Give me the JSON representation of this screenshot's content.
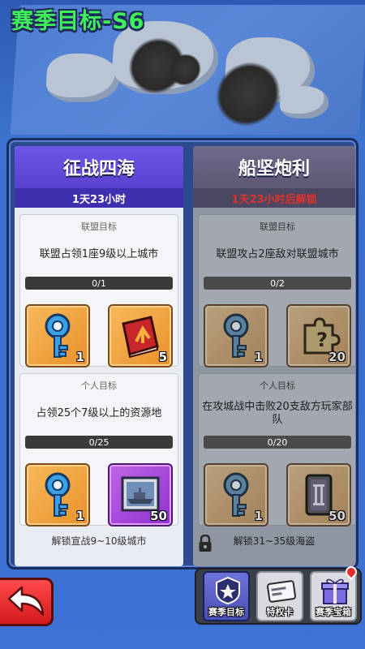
{
  "header": {
    "title": "赛季目标-S6"
  },
  "columns": [
    {
      "name": "征战四海",
      "time": "1天23小时",
      "locked": false,
      "alliance": {
        "label": "联盟目标",
        "task": "联盟占领1座9级以上城市",
        "progress": "0/1",
        "rewards": [
          {
            "icon": "blue-key-icon",
            "qty": "1"
          },
          {
            "icon": "red-book-icon",
            "qty": "5"
          }
        ]
      },
      "personal": {
        "label": "个人目标",
        "task": "占领25个7级以上的资源地",
        "progress": "0/25",
        "rewards": [
          {
            "icon": "blue-key-icon",
            "qty": "1"
          },
          {
            "icon": "warship-card-icon",
            "qty": "50"
          }
        ]
      },
      "unlock": "解锁宣战9~10级城市"
    },
    {
      "name": "船坚炮利",
      "time": "1天23小时后解锁",
      "locked": true,
      "alliance": {
        "label": "联盟目标",
        "task": "联盟攻占2座敌对联盟城市",
        "progress": "0/2",
        "rewards": [
          {
            "icon": "blue-key-icon",
            "qty": "1"
          },
          {
            "icon": "mystery-puzzle-icon",
            "qty": "20"
          }
        ]
      },
      "personal": {
        "label": "个人目标",
        "task": "在攻城战中击败20支敌方玩家部队",
        "progress": "0/20",
        "rewards": [
          {
            "icon": "blue-key-icon",
            "qty": "1"
          },
          {
            "icon": "roman-two-token-icon",
            "qty": "50"
          }
        ]
      },
      "unlock": "解锁31~35级海盗"
    }
  ],
  "tabs": [
    {
      "label": "赛季目标",
      "icon": "season-badge-icon",
      "active": true
    },
    {
      "label": "特权卡",
      "icon": "privilege-card-icon",
      "active": false
    },
    {
      "label": "赛季宝箱",
      "icon": "gift-box-icon",
      "active": false,
      "notify": true
    }
  ],
  "colors": {
    "title_green": "#3ef05a",
    "active_header": "#5a41d0",
    "locked_time": "#e0312c",
    "back_button": "#d3191c"
  }
}
